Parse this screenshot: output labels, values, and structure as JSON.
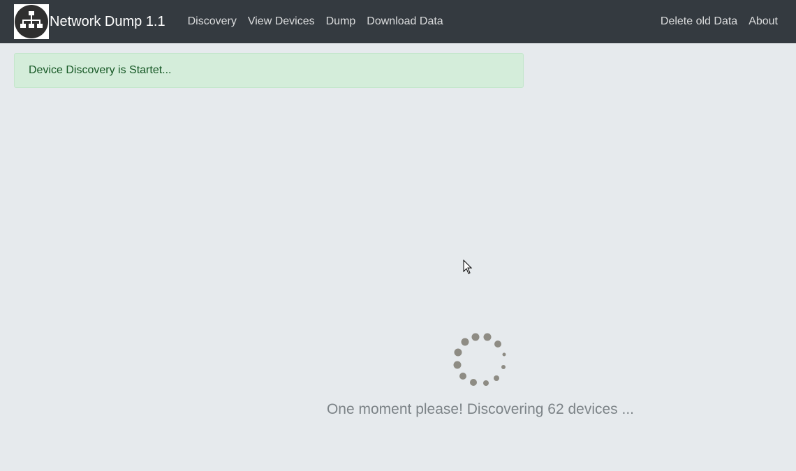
{
  "app": {
    "title": "Network Dump 1.1",
    "logo_icon": "network-hierarchy-icon"
  },
  "nav": {
    "left": [
      "Discovery",
      "View Devices",
      "Dump",
      "Download Data"
    ],
    "right": [
      "Delete old Data",
      "About"
    ]
  },
  "alert": {
    "message": "Device Discovery is Startet...",
    "type": "success"
  },
  "loading": {
    "message": "One moment please! Discovering 62 devices ...",
    "spinner_icon": "loading-dots-spinner-icon"
  },
  "colors": {
    "navbar_bg": "#343a40",
    "page_bg": "#e6eaed",
    "alert_bg": "#d4edda",
    "alert_text": "#155724",
    "spinner": "#8e8c84"
  }
}
